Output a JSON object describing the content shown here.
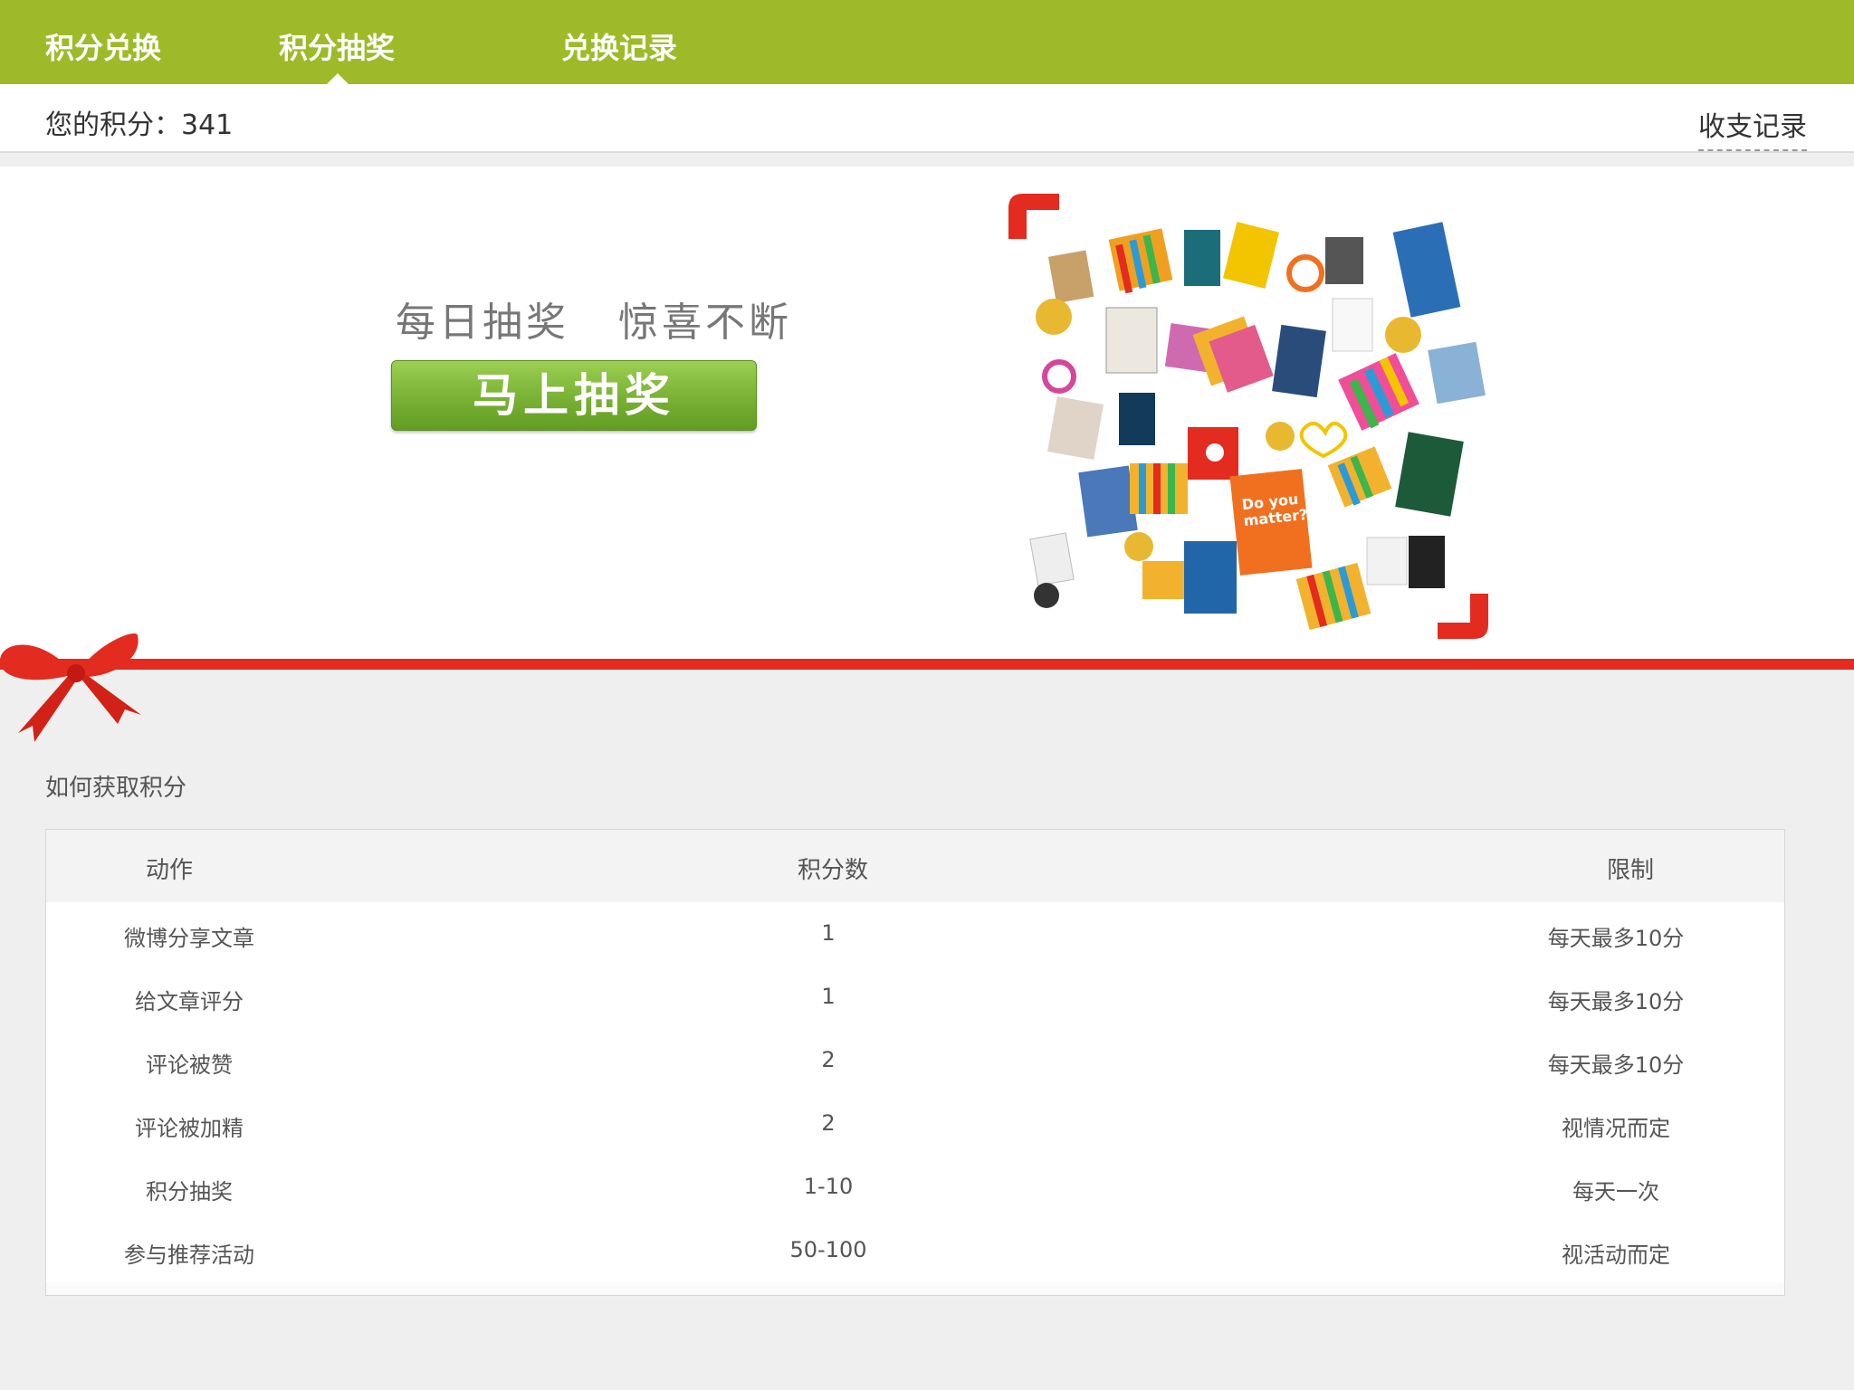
{
  "nav": {
    "tabs": [
      {
        "label": "积分兑换"
      },
      {
        "label": "积分抽奖"
      },
      {
        "label": "兑换记录"
      }
    ]
  },
  "points_bar": {
    "label": "您的积分：341",
    "ledger_link": "收支记录"
  },
  "hero": {
    "slogan": "每日抽奖   惊喜不断",
    "draw_button": "马上抽奖"
  },
  "how_to": {
    "title": "如何获取积分",
    "headers": [
      "动作",
      "积分数",
      "限制"
    ],
    "rows": [
      {
        "action": "微博分享文章",
        "points": "1",
        "limit": "每天最多10分"
      },
      {
        "action": "给文章评分",
        "points": "1",
        "limit": "每天最多10分"
      },
      {
        "action": "评论被赞",
        "points": "2",
        "limit": "每天最多10分"
      },
      {
        "action": "评论被加精",
        "points": "2",
        "limit": "视情况而定"
      },
      {
        "action": "积分抽奖",
        "points": "1-10",
        "limit": "每天一次"
      },
      {
        "action": "参与推荐活动",
        "points": "50-100",
        "limit": "视活动而定"
      }
    ]
  },
  "colors": {
    "nav_green": "#9fba28",
    "button_green": "#78b133",
    "ribbon_red": "#e32b1f"
  }
}
